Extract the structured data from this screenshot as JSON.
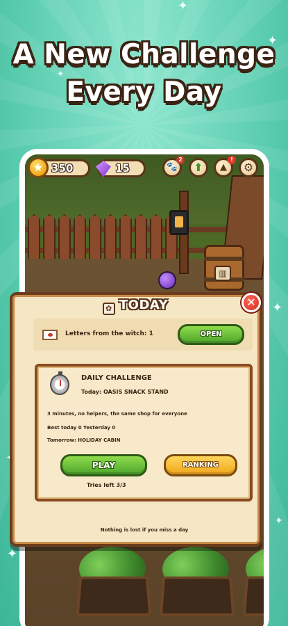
{
  "headline": {
    "line1": "A New Challenge",
    "line2": "Every Day"
  },
  "hud": {
    "coins": "350",
    "gems": "15",
    "paw_badge": "2",
    "alert_badge": "!"
  },
  "dialog": {
    "title": "TODAY",
    "letters_label": "Letters from the witch: 1",
    "open_label": "OPEN",
    "challenge": {
      "heading": "DAILY CHALLENGE",
      "today": "Today: OASIS SNACK STAND",
      "rules": "3 minutes, no helpers, the same shop for everyone",
      "best": "Best today 0  Yesterday 0",
      "tomorrow": "Tomorrow: HOLIDAY CABIN",
      "play_label": "PLAY",
      "ranking_label": "RANKING",
      "tries": "Tries left 3/3"
    },
    "footer": "Nothing is lost if you miss a day"
  },
  "colors": {
    "background": "#5fcfb2",
    "outline": "#3b2414",
    "play_green": "#6cc23a",
    "ranking_yellow": "#f7bd2a",
    "close_red": "#e0392a"
  },
  "icons": [
    "coin-icon",
    "gem-icon",
    "paw-icon",
    "arrow-up-icon",
    "witch-hat-icon",
    "gear-icon",
    "close-icon",
    "envelope-icon",
    "stopwatch-icon"
  ]
}
